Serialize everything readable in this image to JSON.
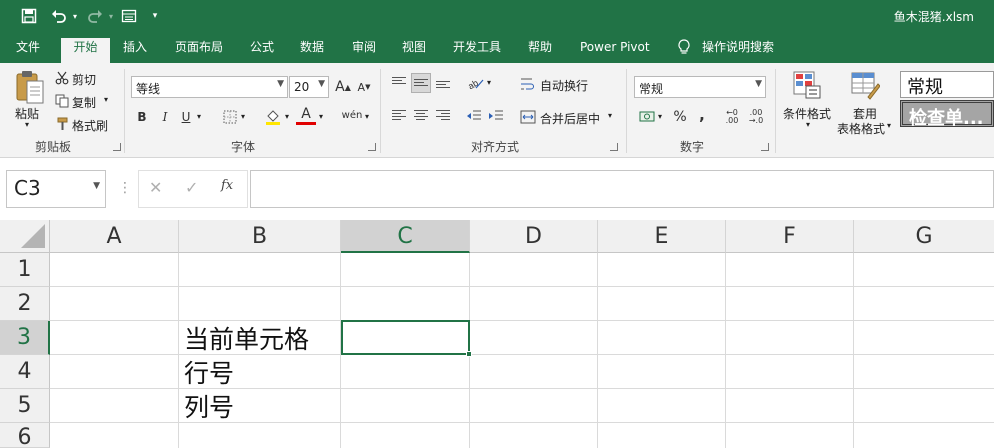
{
  "window": {
    "title": "鱼木混猪.xlsm"
  },
  "quick_access": {
    "save": "save-icon",
    "undo": "undo-icon",
    "redo": "redo-icon",
    "form": "form-icon",
    "customize": "customize-icon"
  },
  "tabs": [
    "文件",
    "开始",
    "插入",
    "页面布局",
    "公式",
    "数据",
    "审阅",
    "视图",
    "开发工具",
    "帮助",
    "Power Pivot"
  ],
  "active_tab": "开始",
  "tell_me": "操作说明搜索",
  "ribbon": {
    "clipboard": {
      "paste": "粘贴",
      "cut": "剪切",
      "copy": "复制",
      "format_painter": "格式刷",
      "label": "剪贴板"
    },
    "font": {
      "font_name": "等线",
      "font_size": "20",
      "grow": "A",
      "shrink": "A",
      "bold": "B",
      "italic": "I",
      "underline": "U",
      "font_color": "A",
      "phonetic": "wén",
      "label": "字体"
    },
    "alignment": {
      "wrap": "自动换行",
      "merge": "合并后居中",
      "label": "对齐方式"
    },
    "number": {
      "format": "常规",
      "percent": "%",
      "comma": ",",
      "label": "数字"
    },
    "styles": {
      "conditional": "条件格式",
      "table_line1": "套用",
      "table_line2": "表格格式",
      "normal": "常规",
      "check": "检查单..."
    }
  },
  "formula_bar": {
    "name_box": "C3",
    "cancel": "✕",
    "enter": "✓",
    "fx": "fx",
    "formula": ""
  },
  "sheet": {
    "columns": [
      "A",
      "B",
      "C",
      "D",
      "E",
      "F",
      "G"
    ],
    "rows": [
      "1",
      "2",
      "3",
      "4",
      "5",
      "6"
    ],
    "selected_column": "C",
    "selected_row": "3",
    "cells": {
      "B3": "当前单元格",
      "B4": "行号",
      "B5": "列号"
    }
  },
  "colors": {
    "accent": "#217346",
    "ribbon_bg": "#f3f3f3",
    "header_bg": "#f0f0f0",
    "header_selected": "#d2d2d2"
  }
}
